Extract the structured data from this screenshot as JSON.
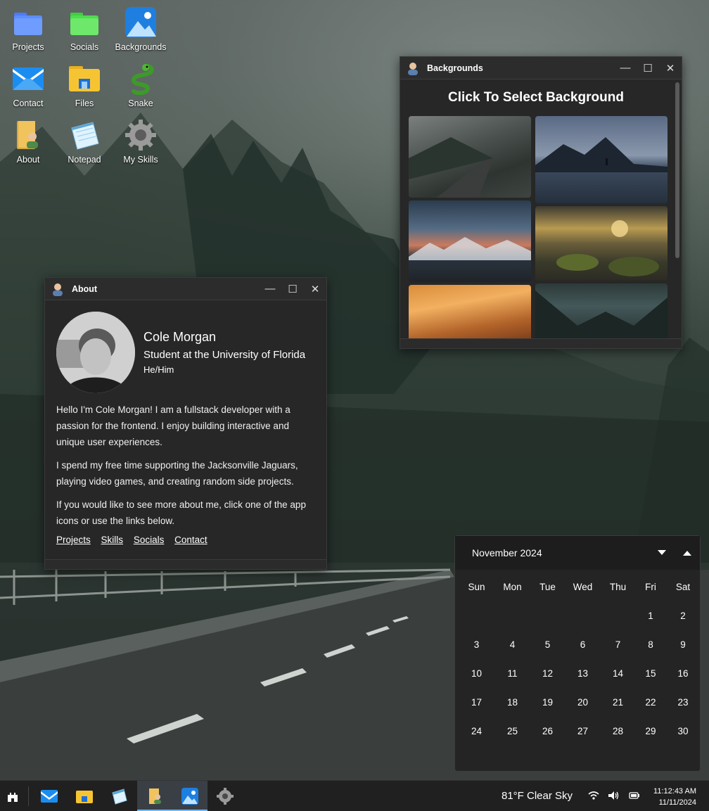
{
  "desktop": {
    "icons": [
      {
        "label": "Projects",
        "icon": "folder-blue-icon"
      },
      {
        "label": "Socials",
        "icon": "folder-green-icon"
      },
      {
        "label": "Backgrounds",
        "icon": "picture-icon"
      },
      {
        "label": "Contact",
        "icon": "mail-icon"
      },
      {
        "label": "Files",
        "icon": "file-explorer-icon"
      },
      {
        "label": "Snake",
        "icon": "snake-icon"
      },
      {
        "label": "About",
        "icon": "user-folder-icon"
      },
      {
        "label": "Notepad",
        "icon": "notepad-icon"
      },
      {
        "label": "My Skills",
        "icon": "gear-icon"
      }
    ]
  },
  "about_window": {
    "title": "About",
    "name": "Cole Morgan",
    "subtitle": "Student at the University of Florida",
    "pronouns": "He/Him",
    "paragraphs": [
      "Hello I'm Cole Morgan! I am a fullstack developer with a passion for the frontend. I enjoy building interactive and unique user experiences.",
      "I spend my free time supporting the Jacksonville Jaguars, playing video games, and creating random side projects.",
      "If you would like to see more about me, click one of the app icons or use the links below."
    ],
    "links": [
      "Projects",
      "Skills",
      "Socials",
      "Contact"
    ]
  },
  "backgrounds_window": {
    "title": "Backgrounds",
    "heading": "Click To Select Background",
    "thumbnails": [
      "misty-road",
      "lake-silhouette",
      "stormy-mountains",
      "rocky-sunset",
      "orange-clouds",
      "forest-valley"
    ]
  },
  "window_controls": {
    "minimize": "—",
    "maximize": "☐",
    "close": "✕"
  },
  "calendar": {
    "month_label": "November 2024",
    "weekdays": [
      "Sun",
      "Mon",
      "Tue",
      "Wed",
      "Thu",
      "Fri",
      "Sat"
    ],
    "leading_blanks": 5,
    "days": [
      "1",
      "2",
      "3",
      "4",
      "5",
      "6",
      "7",
      "8",
      "9",
      "10",
      "11",
      "12",
      "13",
      "14",
      "15",
      "16",
      "17",
      "18",
      "19",
      "20",
      "21",
      "22",
      "23",
      "24",
      "25",
      "26",
      "27",
      "28",
      "29",
      "30"
    ]
  },
  "taskbar": {
    "weather": "81°F Clear Sky",
    "time": "11:12:43 AM",
    "date": "11/11/2024",
    "accent": "#6cb8ff"
  }
}
